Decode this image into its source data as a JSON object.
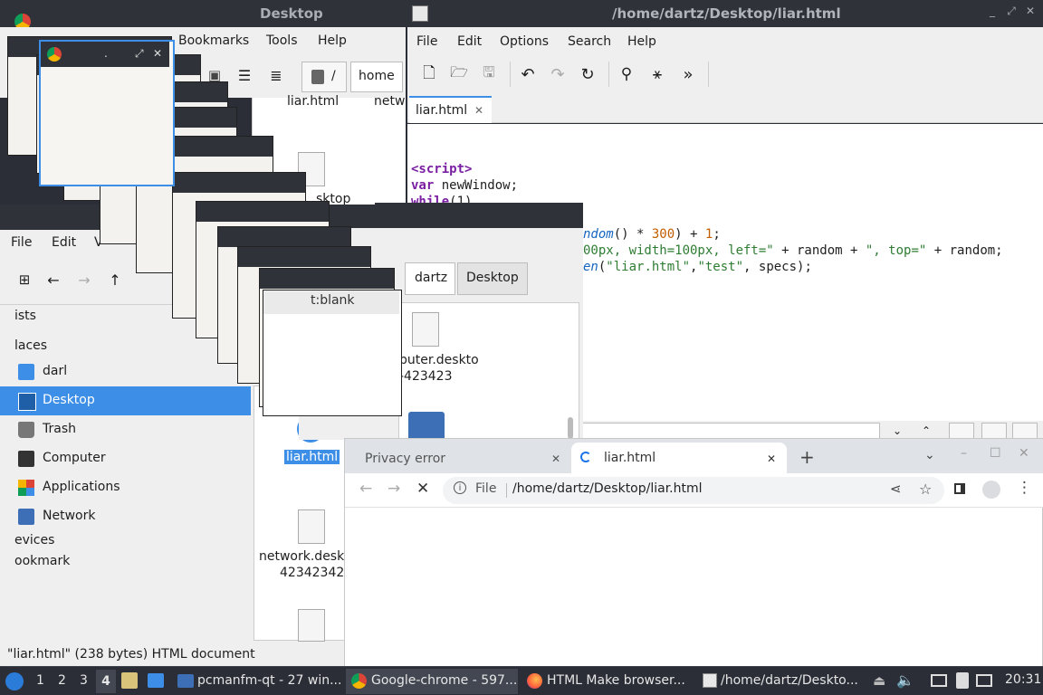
{
  "fm": {
    "title": "Desktop",
    "menu": [
      "Bookmarks",
      "Tools",
      "Help"
    ],
    "menu2": [
      "File",
      "Edit",
      "V"
    ],
    "path_root": "/",
    "path_home": "home",
    "path_dartz": "dartz",
    "path_desktop": "Desktop",
    "side_lists": "ists",
    "side_places": "laces",
    "side_items": [
      {
        "label": "darl",
        "icon": "home-folder-icon"
      },
      {
        "label": "Desktop",
        "icon": "desktop-icon"
      },
      {
        "label": "Trash",
        "icon": "trash-icon"
      },
      {
        "label": "Computer",
        "icon": "computer-icon"
      },
      {
        "label": "Applications",
        "icon": "applications-icon"
      },
      {
        "label": "Network",
        "icon": "network-icon"
      }
    ],
    "side_devices": "evices",
    "side_bookmarks": "ookmark",
    "files_top": [
      "liar.html",
      "netw"
    ],
    "file_desktop_partial": "sktop",
    "file_computer": "puter.deskto",
    "file_computer_sub": "-423423",
    "file_liar": "liar.html",
    "file_network": "network.desk",
    "file_network_sub": "42342342",
    "status": "\"liar.html\" (238 bytes) HTML document",
    "about_blank": "t:blank"
  },
  "editor": {
    "title": "/home/dartz/Desktop/liar.html",
    "menu": [
      "File",
      "Edit",
      "Options",
      "Search",
      "Help"
    ],
    "tab": "liar.html",
    "lines": {
      "l1": "<script>",
      "l2a": "var",
      "l2b": " newWindow;",
      "l3a": "while",
      "l3b": "(1)",
      "l4a": "ndom",
      "l4b": "() * ",
      "l4c": "300",
      "l4d": ") + ",
      "l4e": "1",
      "l4f": ";",
      "l5a": "00px, width=100px, left=\"",
      "l5b": " + random + ",
      "l5c": "\", top=\"",
      "l5d": " + random;",
      "l6a": "en",
      "l6b": "(",
      "l6c": "\"liar.html\"",
      "l6d": ",",
      "l6e": "\"test\"",
      "l6f": ", specs);"
    }
  },
  "chrome": {
    "tab_inactive": "Privacy error",
    "tab_active": "liar.html",
    "address_scheme": "File",
    "address_url": "/home/dartz/Desktop/liar.html"
  },
  "taskbar": {
    "workspaces": [
      "1",
      "2",
      "3",
      "4"
    ],
    "active_workspace": "4",
    "tasks": [
      "pcmanfm-qt - 27 win...",
      "Google-chrome - 597...",
      "HTML Make browser...",
      "/home/dartz/Deskto..."
    ],
    "clock": "20:31"
  },
  "colors": {
    "accent": "#3d8ee6",
    "titlebar": "#2f3238",
    "taskbar": "#2b2e37"
  }
}
